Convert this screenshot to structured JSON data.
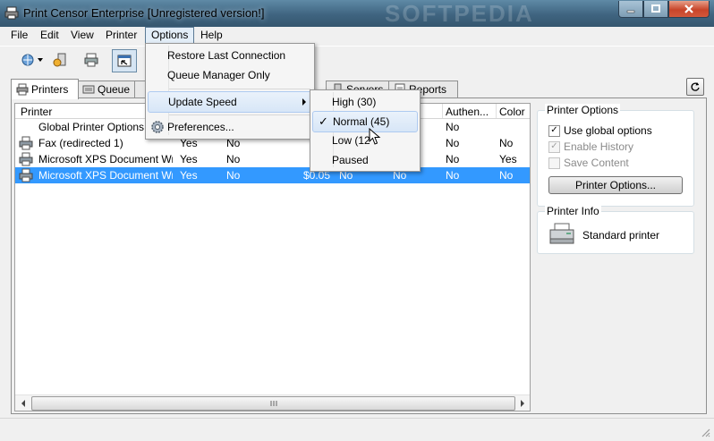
{
  "window": {
    "title": "Print Censor Enterprise [Unregistered version!]",
    "watermark": "SOFTPEDIA"
  },
  "menubar": {
    "items": [
      "File",
      "Edit",
      "View",
      "Printer",
      "Options",
      "Help"
    ],
    "active": "Options"
  },
  "options_menu": {
    "items": [
      "Restore Last Connection",
      "Queue Manager Only",
      "Update Speed",
      "Preferences..."
    ]
  },
  "speed_submenu": {
    "items": [
      "High (30)",
      "Normal (45)",
      "Low (120)",
      "Paused"
    ],
    "checked": "Normal (45)",
    "low_visible": "Low (12"
  },
  "tabs": [
    "Printers",
    "Queue",
    "Servers",
    "Reports"
  ],
  "printer_list": {
    "columns": [
      "Printer",
      "Authen...",
      "Color"
    ],
    "rows": [
      {
        "name": "Global Printer Options",
        "c1": "",
        "c2": "",
        "c3": "",
        "c4": "",
        "c5": "",
        "auth": "No",
        "color": ""
      },
      {
        "name": "Fax (redirected 1)",
        "c1": "Yes",
        "c2": "No",
        "c3": "",
        "c4": "",
        "c5": "",
        "auth": "No",
        "color": "No"
      },
      {
        "name": "Microsoft XPS Document Wr...",
        "c1": "Yes",
        "c2": "No",
        "c3": "",
        "c4": "",
        "c5": "",
        "auth": "No",
        "color": "Yes"
      },
      {
        "name": "Microsoft XPS Document Wr...",
        "c1": "Yes",
        "c2": "No",
        "c3": "$0.05",
        "c4": "No",
        "c5": "No",
        "auth": "No",
        "color": "No"
      }
    ],
    "selected_index": 3
  },
  "printer_options": {
    "title": "Printer Options",
    "use_global": "Use global options",
    "enable_history": "Enable History",
    "save_content": "Save Content",
    "button": "Printer Options..."
  },
  "printer_info": {
    "title": "Printer Info",
    "type": "Standard printer"
  },
  "colors": {
    "selection": "#3399ff",
    "titlebar": "#3f6480"
  }
}
